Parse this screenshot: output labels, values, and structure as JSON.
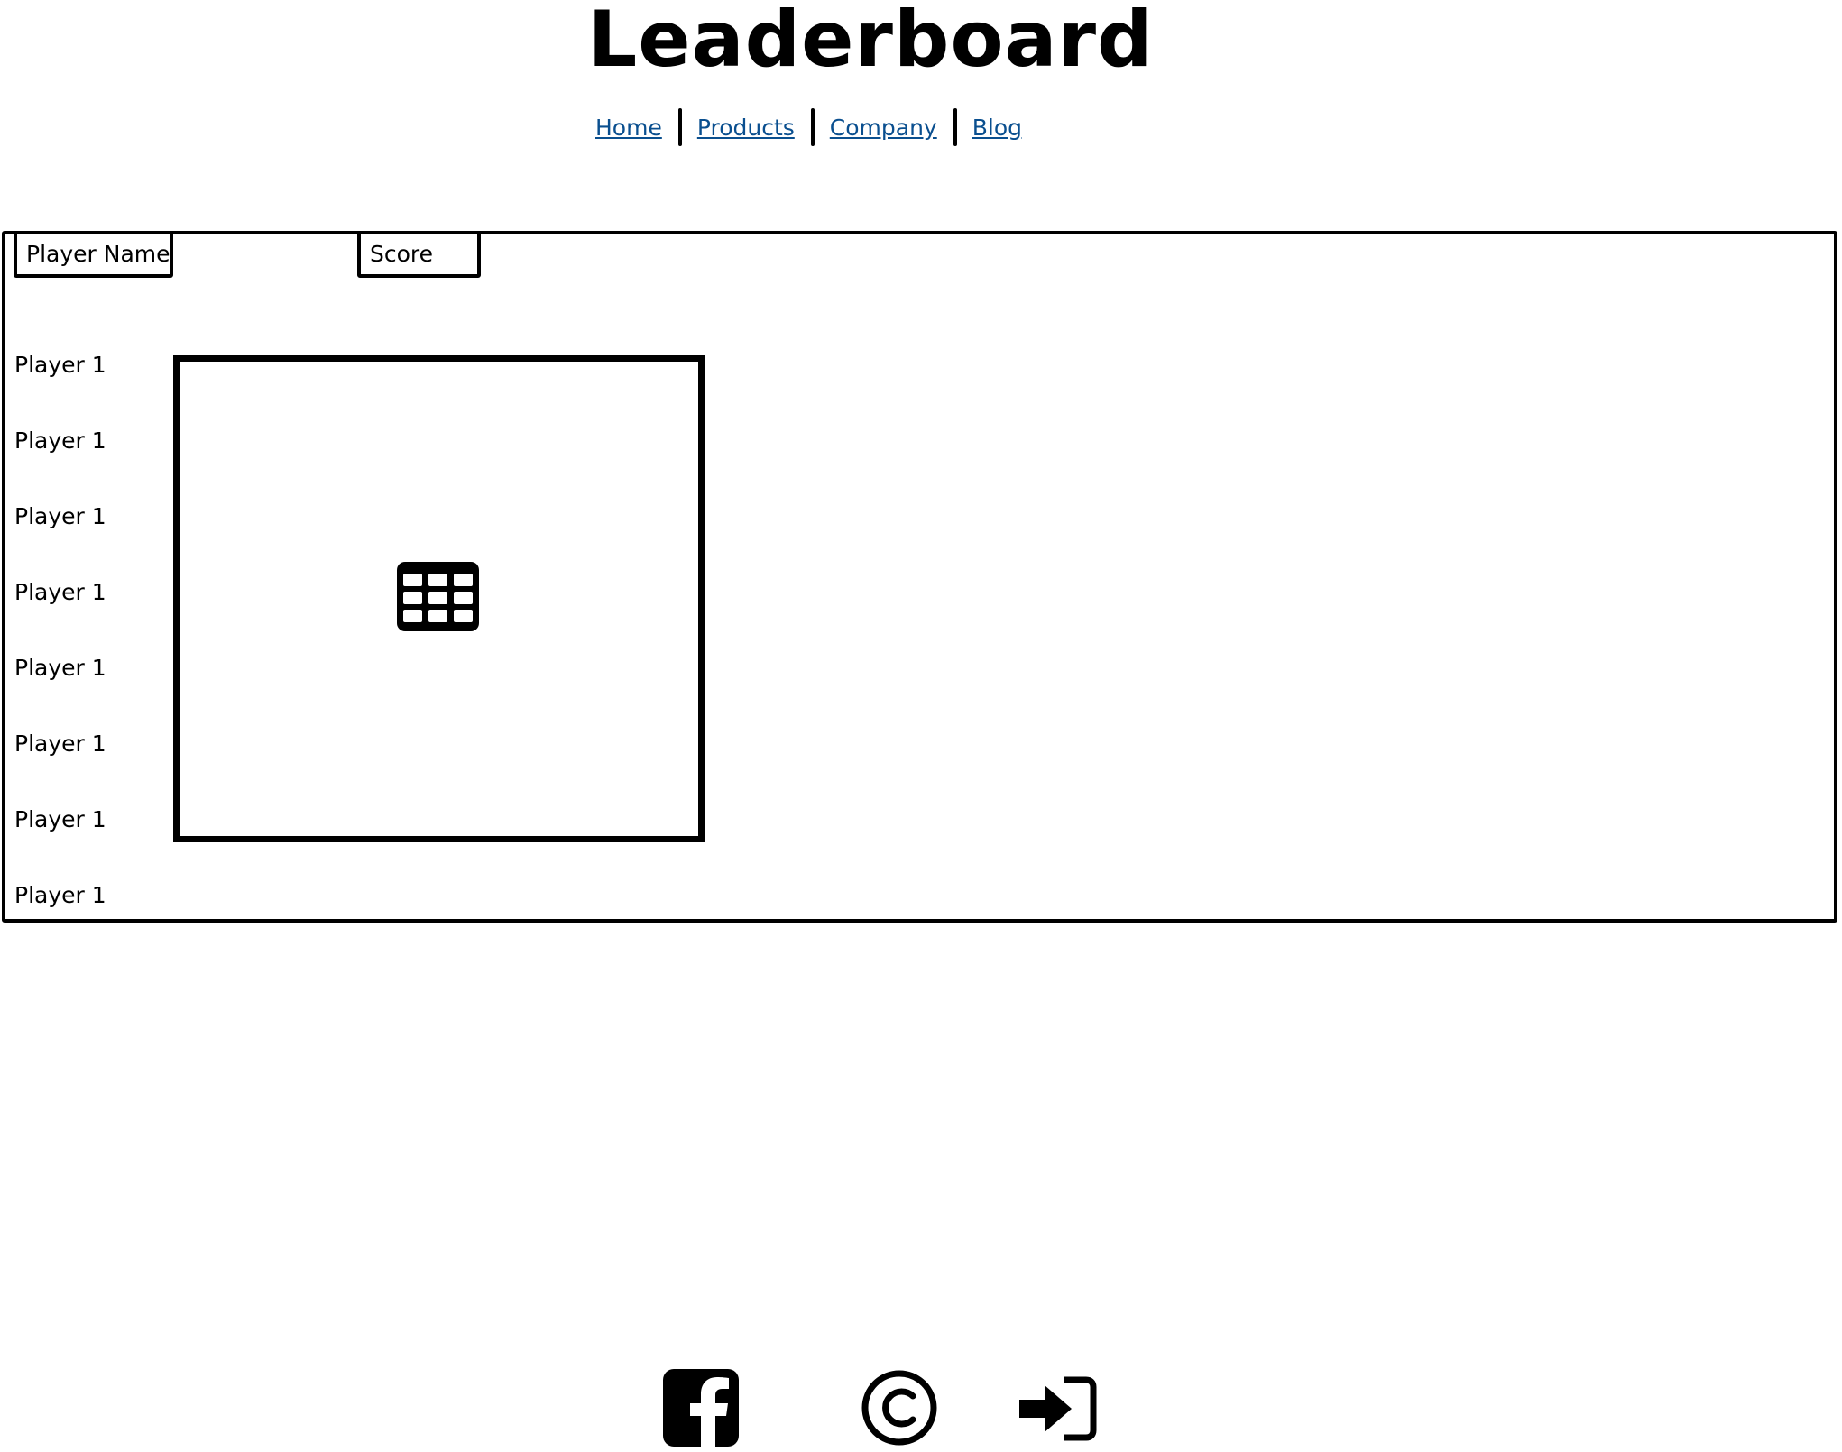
{
  "page": {
    "title": "Leaderboard"
  },
  "nav": {
    "items": [
      {
        "label": "Home"
      },
      {
        "label": "Products"
      },
      {
        "label": "Company"
      },
      {
        "label": "Blog"
      }
    ],
    "link_color": "#0a4f8f"
  },
  "leaderboard": {
    "columns": {
      "player_name": "Player Name",
      "score": "Score"
    },
    "rows": [
      {
        "name": "Player 1"
      },
      {
        "name": "Player 1"
      },
      {
        "name": "Player 1"
      },
      {
        "name": "Player 1"
      },
      {
        "name": "Player 1"
      },
      {
        "name": "Player 1"
      },
      {
        "name": "Player 1"
      },
      {
        "name": "Player 1"
      }
    ],
    "placeholder_icon": "table-icon"
  },
  "footer": {
    "icons": [
      "facebook-icon",
      "copyright-icon",
      "login-icon"
    ]
  }
}
